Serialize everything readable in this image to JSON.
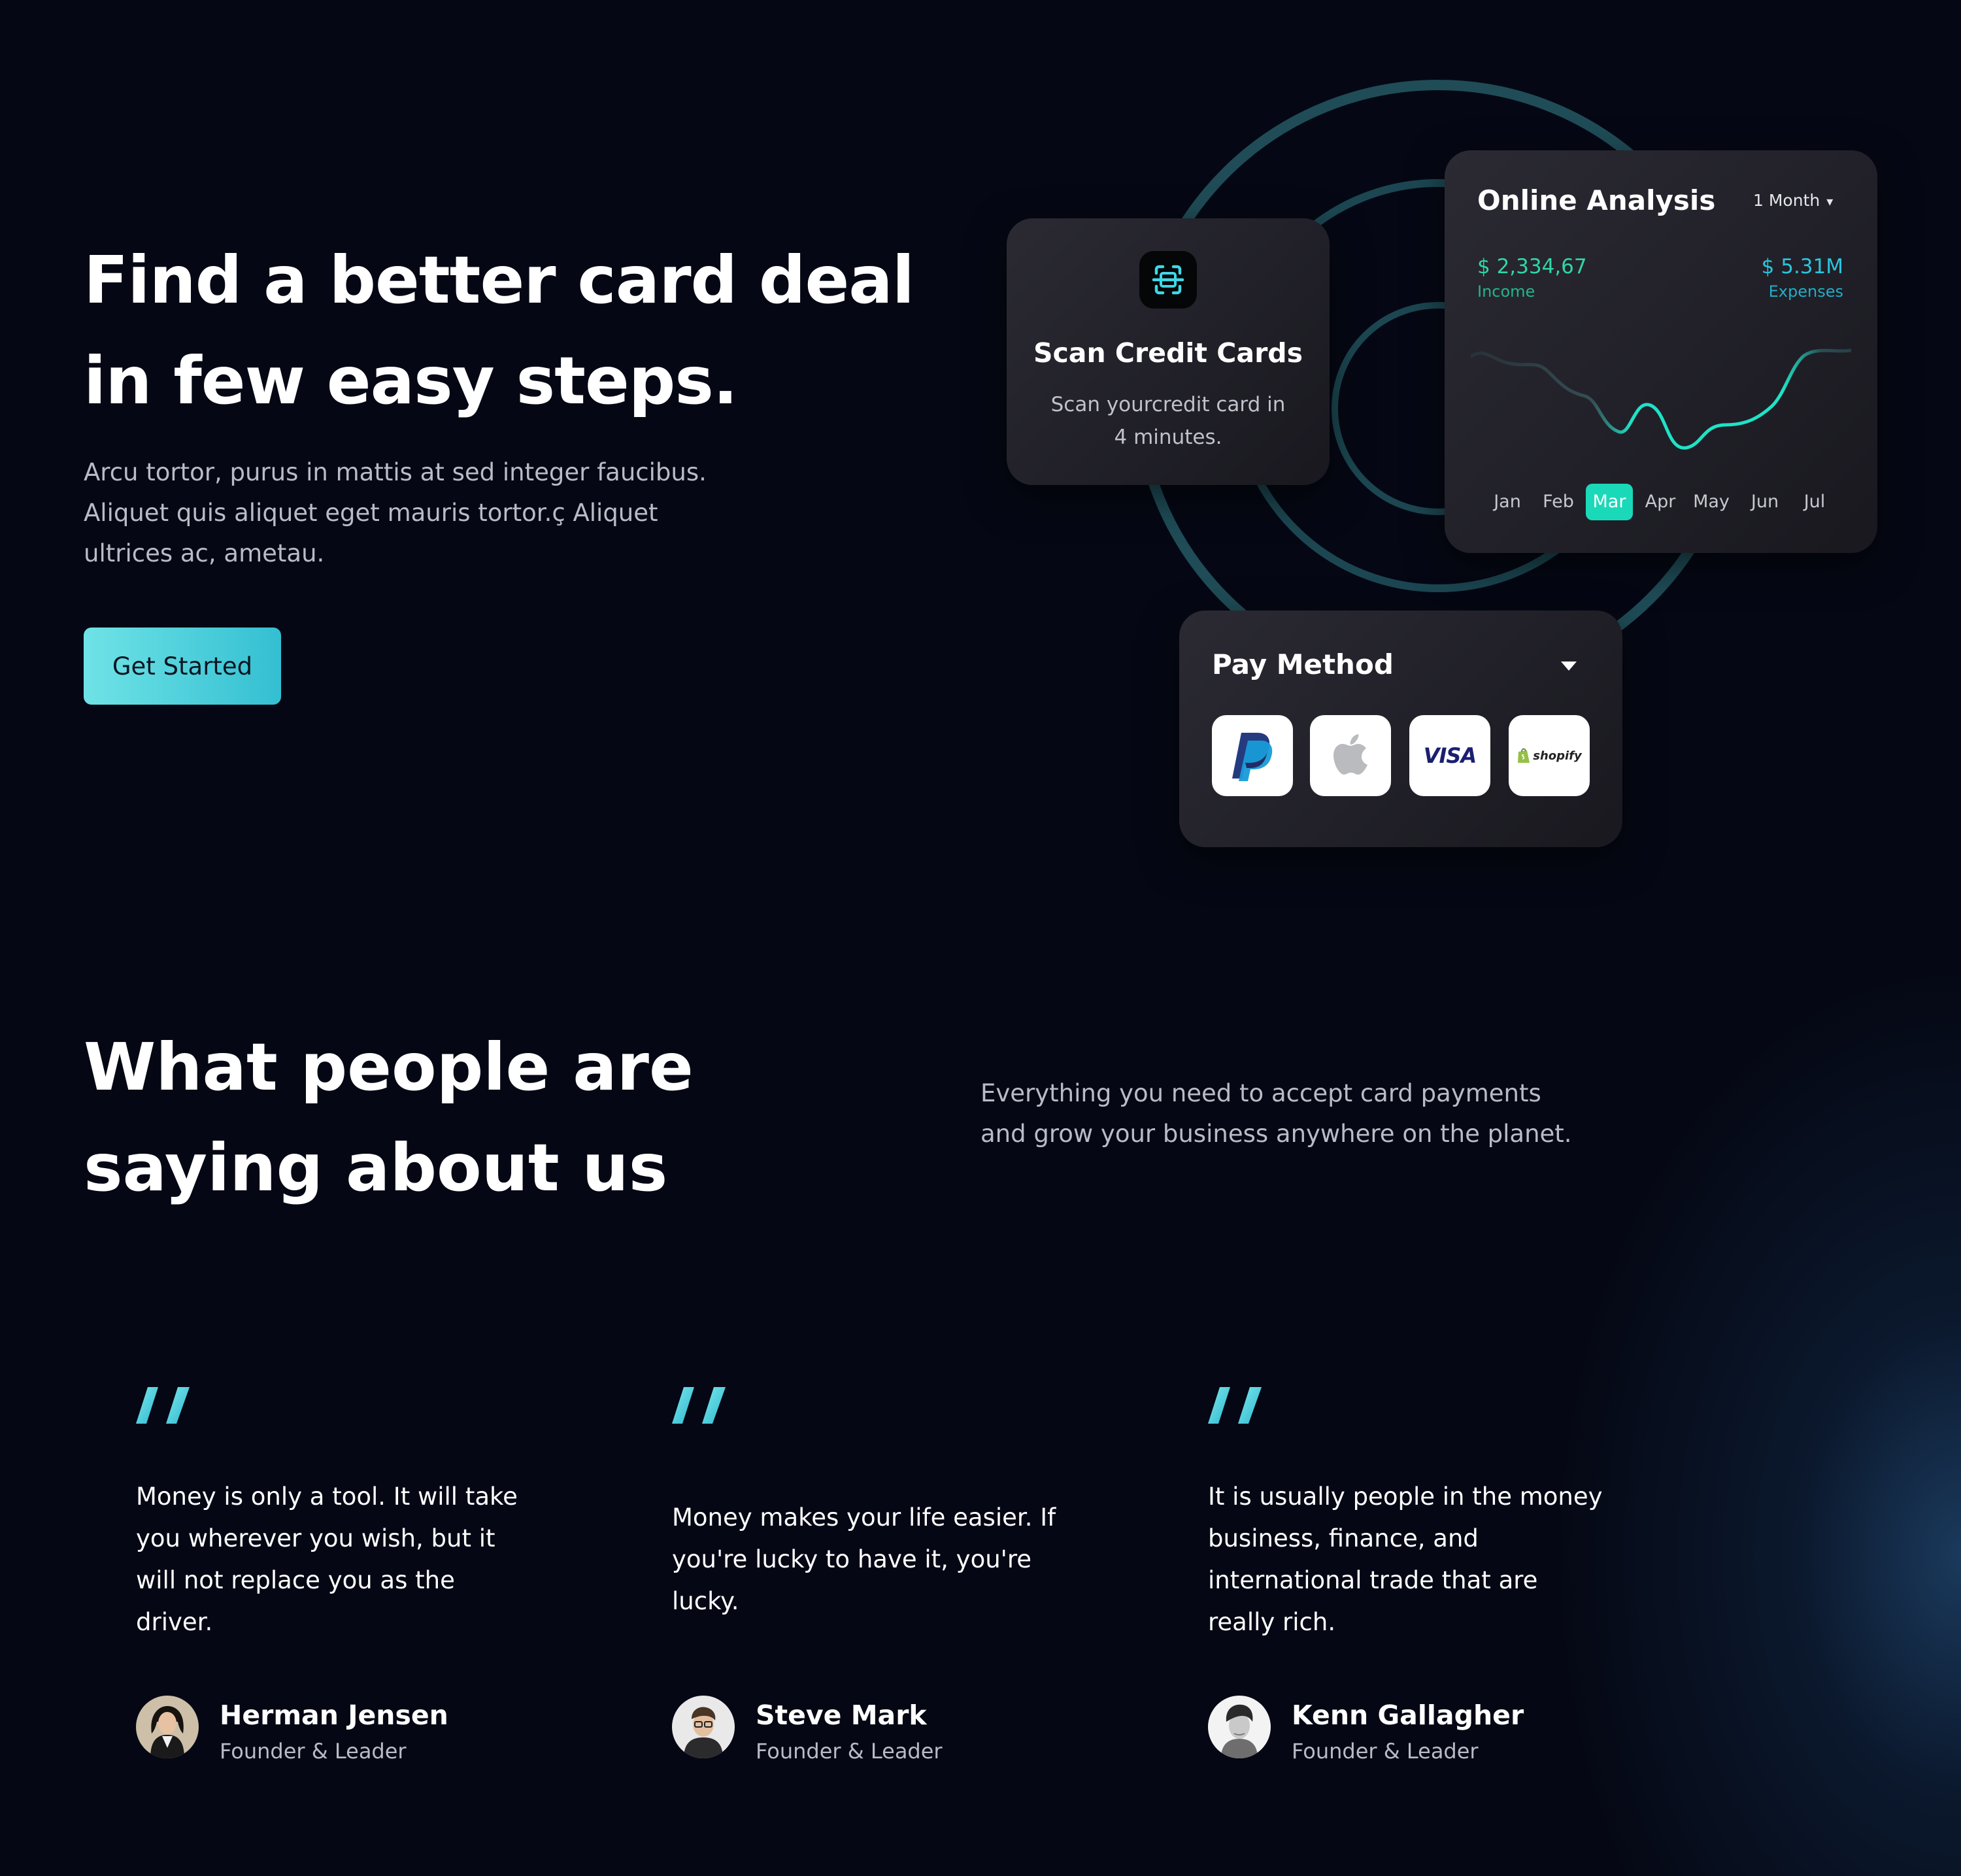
{
  "hero": {
    "title_lines": [
      "Find a better card deal",
      "in few easy steps."
    ],
    "description_lines": [
      "Arcu tortor, purus in mattis at sed integer faucibus.",
      "Aliquet quis aliquet eget mauris tortor.ç Aliquet",
      "ultrices ac, ametau."
    ],
    "cta_label": "Get Started"
  },
  "scan_card": {
    "icon": "scan-icon",
    "title": "Scan Credit Cards",
    "subtitle_lines": [
      "Scan yourcredit card in",
      "4 minutes."
    ]
  },
  "analysis_card": {
    "title": "Online Analysis",
    "period": "1 Month",
    "income_value": "$ 2,334,67",
    "income_label": "Income",
    "expenses_value": "$ 5.31M",
    "expenses_label": "Expenses",
    "months": [
      "Jan",
      "Feb",
      "Mar",
      "Apr",
      "May",
      "Jun",
      "Jul"
    ],
    "active_month": "Mar"
  },
  "pay_card": {
    "title": "Pay Method",
    "methods": [
      {
        "name": "PayPal",
        "icon": "paypal-icon"
      },
      {
        "name": "Apple",
        "icon": "apple-icon"
      },
      {
        "name": "VISA",
        "icon": "visa-icon"
      },
      {
        "name": "shopify",
        "icon": "shopify-icon"
      }
    ]
  },
  "testimonials": {
    "title_lines": [
      "What people are",
      "saying about us"
    ],
    "subtitle_lines": [
      "Everything you need to accept card payments",
      "and grow your business anywhere on the planet."
    ],
    "items": [
      {
        "quote_lines": [
          "Money is only a tool. It will take",
          "you wherever you wish, but it",
          "will not replace you as the",
          "driver."
        ],
        "name": "Herman Jensen",
        "role": "Founder & Leader"
      },
      {
        "quote_lines": [
          "Money makes your life easier. If",
          "you're lucky to have it, you're",
          "lucky."
        ],
        "name": "Steve Mark",
        "role": "Founder & Leader"
      },
      {
        "quote_lines": [
          "It is usually people in the money",
          "business, finance, and",
          "international trade that are",
          "really rich."
        ],
        "name": "Kenn Gallagher",
        "role": "Founder & Leader"
      }
    ]
  },
  "colors": {
    "background": "#050814",
    "accent_teal": "#33bfd2",
    "income_green": "#2fd6a6",
    "chart_line": "#1ee3c6",
    "ring": "#1f4c57"
  }
}
